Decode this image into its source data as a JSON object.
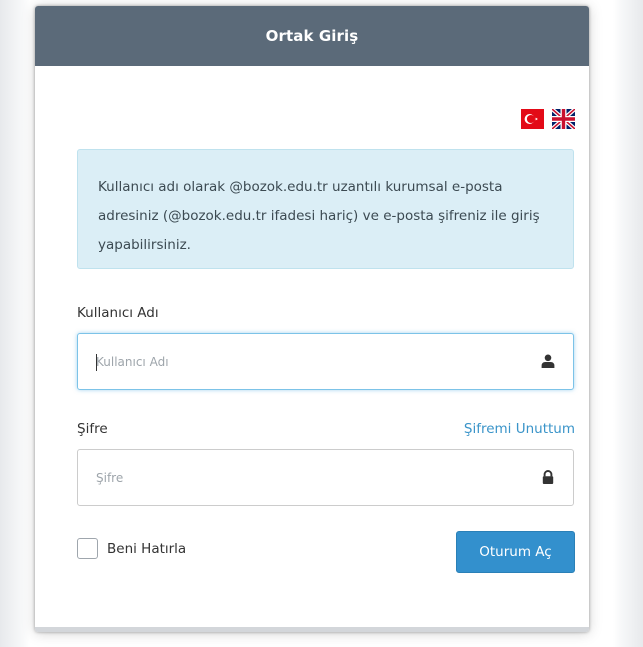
{
  "header": {
    "title": "Ortak Giriş"
  },
  "info": {
    "message": "Kullanıcı adı olarak @bozok.edu.tr uzantılı kurumsal e-posta adresiniz (@bozok.edu.tr ifadesi hariç) ve e-posta şifreniz ile giriş yapabilirsiniz."
  },
  "language_flags": [
    "turkish-flag-icon",
    "uk-flag-icon"
  ],
  "username": {
    "label": "Kullanıcı Adı",
    "placeholder": "Kullanıcı Adı",
    "value": "",
    "icon": "user-icon"
  },
  "password": {
    "label": "Şifre",
    "placeholder": "Şifre",
    "value": "",
    "icon": "lock-icon",
    "forgot_link": "Şifremi Unuttum"
  },
  "remember": {
    "label": "Beni Hatırla",
    "checked": false
  },
  "login_button": {
    "label": "Oturum Aç"
  },
  "colors": {
    "header_bg": "#5b6a79",
    "info_bg": "#dbeef6",
    "link": "#3a94c9",
    "primary_button": "#3390cd"
  }
}
